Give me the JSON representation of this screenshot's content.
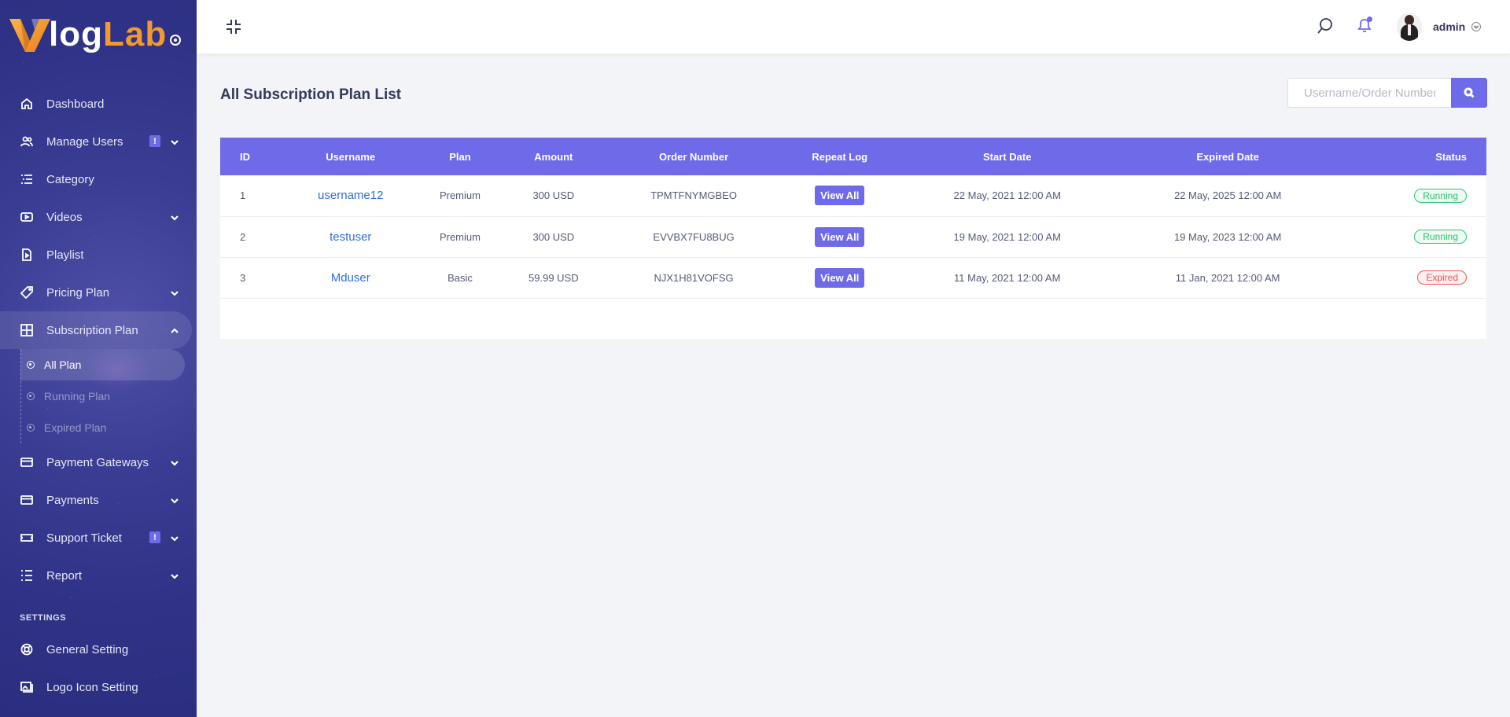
{
  "brand": {
    "logo_text_white": "log",
    "logo_text_orange": "Lab"
  },
  "sidebar": {
    "items": [
      {
        "label": "Dashboard"
      },
      {
        "label": "Manage Users",
        "badge": "!"
      },
      {
        "label": "Category"
      },
      {
        "label": "Videos"
      },
      {
        "label": "Playlist"
      },
      {
        "label": "Pricing Plan"
      },
      {
        "label": "Subscription Plan"
      },
      {
        "label": "Payment Gateways"
      },
      {
        "label": "Payments"
      },
      {
        "label": "Support Ticket",
        "badge": "!"
      },
      {
        "label": "Report"
      }
    ],
    "subscription_sub": [
      {
        "label": "All Plan"
      },
      {
        "label": "Running Plan"
      },
      {
        "label": "Expired Plan"
      }
    ],
    "settings_heading": "SETTINGS",
    "settings_items": [
      {
        "label": "General Setting"
      },
      {
        "label": "Logo Icon Setting"
      }
    ]
  },
  "topbar": {
    "username": "admin"
  },
  "main": {
    "title": "All Subscription Plan List",
    "search": {
      "placeholder": "Username/Order Number",
      "value": ""
    }
  },
  "table": {
    "headers": [
      "ID",
      "Username",
      "Plan",
      "Amount",
      "Order Number",
      "Repeat Log",
      "Start Date",
      "Expired Date",
      "Status"
    ],
    "rows": [
      {
        "id": "1",
        "username": "username12",
        "plan": "Premium",
        "amount": "300 USD",
        "order": "TPMTFNYMGBEO",
        "repeat": "View All",
        "start": "22 May, 2021 12:00 AM",
        "expired": "22 May, 2025 12:00 AM",
        "status": "Running"
      },
      {
        "id": "2",
        "username": "testuser",
        "plan": "Premium",
        "amount": "300 USD",
        "order": "EVVBX7FU8BUG",
        "repeat": "View All",
        "start": "19 May, 2021 12:00 AM",
        "expired": "19 May, 2023 12:00 AM",
        "status": "Running"
      },
      {
        "id": "3",
        "username": "Mduser",
        "plan": "Basic",
        "amount": "59.99 USD",
        "order": "NJX1H81VOFSG",
        "repeat": "View All",
        "start": "11 May, 2021 12:00 AM",
        "expired": "11 Jan, 2021 12:00 AM",
        "status": "Expired"
      }
    ]
  },
  "colors": {
    "accent": "#6f6be8",
    "brand_orange": "#f29a2e",
    "running": "#28c76f",
    "expired": "#ea5455"
  },
  "icons": [
    "home-icon",
    "users-icon",
    "list-icon",
    "video-icon",
    "file-icon",
    "tag-icon",
    "grid-icon",
    "card-icon",
    "ticket-icon",
    "report-icon",
    "lifebuoy-icon",
    "image-icon",
    "search-icon",
    "bell-icon",
    "collapse-icon"
  ]
}
